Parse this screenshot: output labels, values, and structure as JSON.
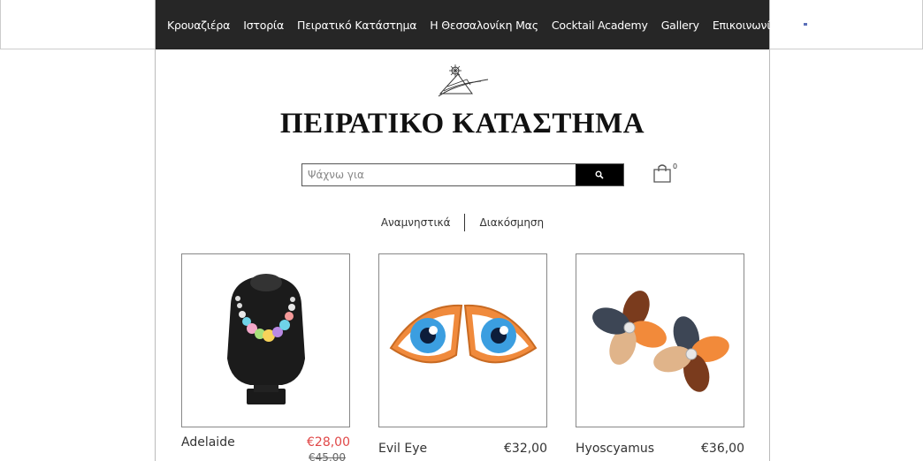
{
  "nav": {
    "items": [
      {
        "label": "Κρουαζιέρα"
      },
      {
        "label": "Ιστορία"
      },
      {
        "label": "Πειρατικό Κατάστημα"
      },
      {
        "label": "Η Θεσσαλονίκη Μας"
      },
      {
        "label": "Cocktail Academy"
      },
      {
        "label": "Gallery"
      },
      {
        "label": "Επικοινωνία"
      }
    ],
    "languages": [
      "greek-flag-icon",
      "us-flag-icon"
    ]
  },
  "logo": {
    "icon": "pirate-ship-logo-icon"
  },
  "page_title": "ΠΕΙΡΑΤΙΚΟ ΚΑΤΑΣΤΗΜΑ",
  "search": {
    "placeholder": "Ψάχνω για",
    "button_icon": "search-icon"
  },
  "cart": {
    "icon": "shopping-bag-icon",
    "count": "0"
  },
  "categories": [
    {
      "label": "Αναμνηστικά"
    },
    {
      "label": "Διακόσμηση"
    }
  ],
  "products": [
    {
      "name": "Adelaide",
      "price": "€28,00",
      "old_price": "€45,00",
      "on_sale": true,
      "image": "necklace-on-bust"
    },
    {
      "name": "Evil Eye",
      "price": "€32,00",
      "image": "evil-eye-earrings"
    },
    {
      "name": "Hyoscyamus",
      "price": "€36,00",
      "image": "flower-earrings"
    }
  ],
  "colors": {
    "nav_bg": "#262626",
    "sale_price": "#e04848",
    "search_button": "#000000"
  }
}
